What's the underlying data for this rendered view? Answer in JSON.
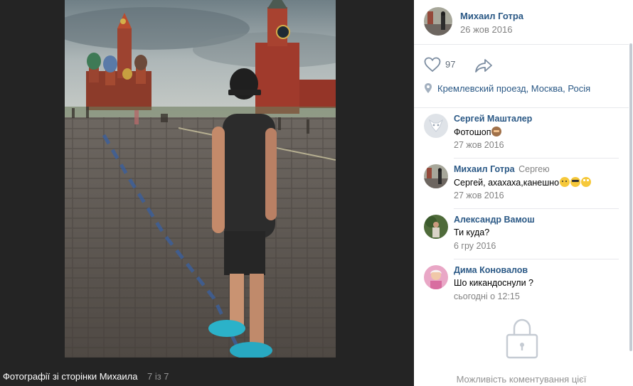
{
  "viewer": {
    "caption_title": "Фотографії зі сторінки Михаила",
    "caption_count": "7 із 7"
  },
  "post": {
    "author_name": "Михаил Готра",
    "date": "26 жов 2016",
    "likes": "97",
    "location": "Кремлевский проезд, Москва, Росія"
  },
  "comments": [
    {
      "author": "Сергей Машталер",
      "reply_to": "",
      "text": "Фотошоп",
      "emoji": [
        "monkey"
      ],
      "time": "27 жов 2016"
    },
    {
      "author": "Михаил Готра",
      "reply_to": "Сергею",
      "text": "Сергей, ахахаха,канешно",
      "emoji": [
        "thinking",
        "cool",
        "roll"
      ],
      "time": "27 жов 2016"
    },
    {
      "author": "Александр Вамош",
      "reply_to": "",
      "text": "Ти куда?",
      "emoji": [],
      "time": "6 гру 2016"
    },
    {
      "author": "Дима Коновалов",
      "reply_to": "",
      "text": "Шо кикандоснули ?",
      "emoji": [],
      "time": "сьогодні о 12:15"
    }
  ],
  "comments_closed_text": "Можливість коментування цієї",
  "icons": [
    "heart-icon",
    "share-arrow-icon",
    "location-pin-icon",
    "lock-icon"
  ],
  "colors": {
    "link": "#2a5885",
    "muted": "#828282",
    "viewer_bg": "#242424"
  }
}
